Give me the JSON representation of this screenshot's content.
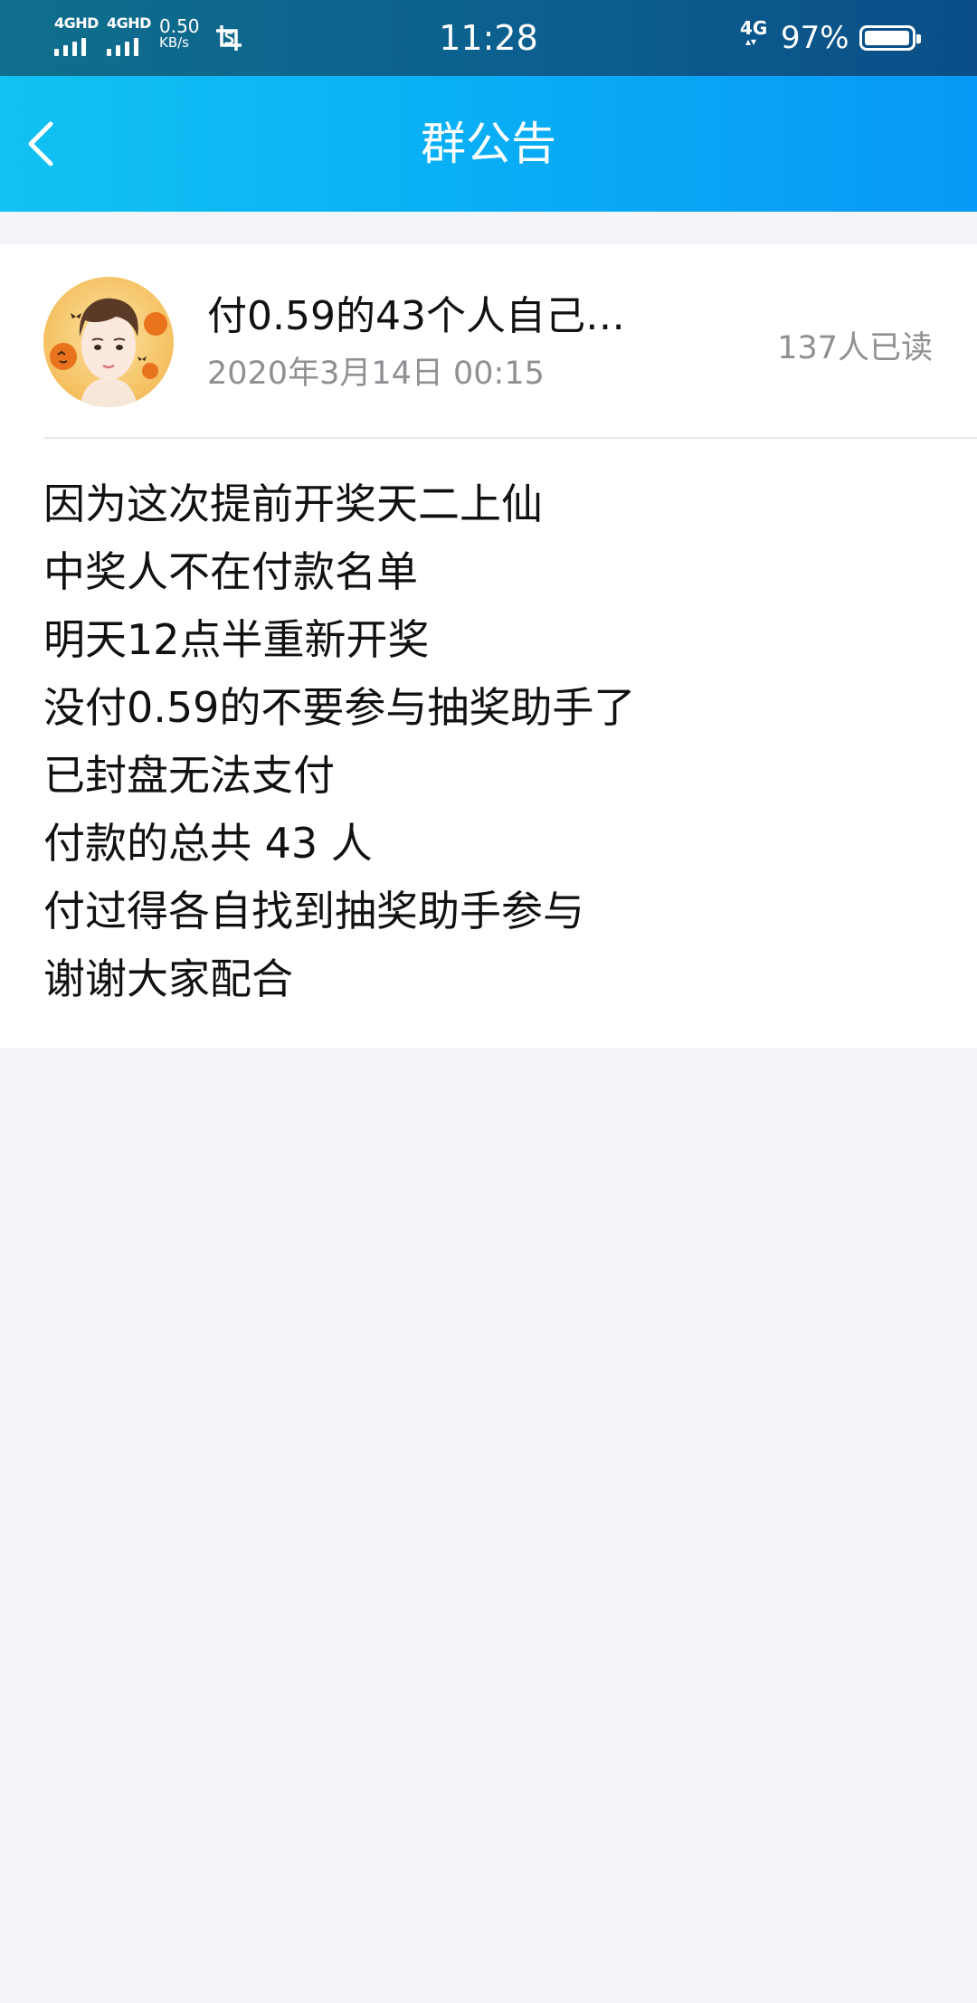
{
  "status_bar": {
    "sim1_label": "4GHD",
    "sim2_label": "4GHD",
    "net_speed_value": "0.50",
    "net_speed_unit": "KB/s",
    "time": "11:28",
    "network_type": "4G",
    "battery_percent": "97%",
    "battery_level": 0.97,
    "icons": [
      "signal-icon",
      "signal-icon",
      "screenshot-icon",
      "network-4g-icon",
      "battery-icon"
    ]
  },
  "header": {
    "title": "群公告",
    "back_icon": "chevron-left-icon"
  },
  "notice": {
    "title": "付0.59的43个人自己…",
    "date": "2020年3月14日 00:15",
    "read_count": "137人已读",
    "body_lines": [
      "因为这次提前开奖天二上仙",
      "中奖人不在付款名单",
      "明天12点半重新开奖",
      "没付0.59的不要参与抽奖助手了",
      "已封盘无法支付",
      "付款的总共 43 人",
      "付过得各自找到抽奖助手参与",
      "谢谢大家配合"
    ]
  },
  "colors": {
    "status_bar": "#0c5f8f",
    "title_bar": "#09aef5",
    "page_background": "#f3f5f9",
    "card_background": "#ffffff",
    "secondary_text": "#8f8f94"
  }
}
